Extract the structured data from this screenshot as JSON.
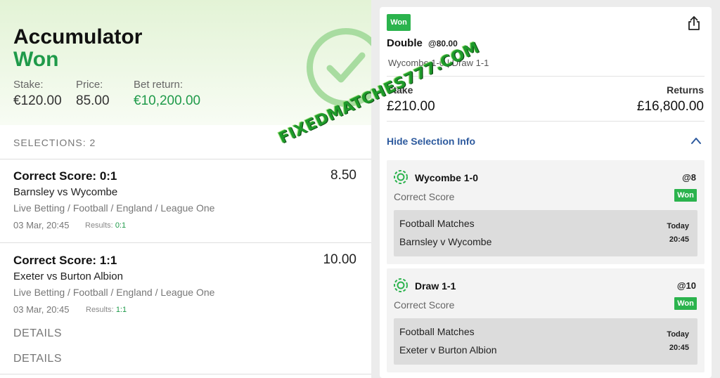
{
  "left": {
    "title": "Accumulator",
    "status": "Won",
    "stake_label": "Stake:",
    "stake_value": "€120.00",
    "price_label": "Price:",
    "price_value": "85.00",
    "return_label": "Bet return:",
    "return_value": "€10,200.00",
    "selections_label": "SELECTIONS: 2",
    "legs": [
      {
        "market": "Correct Score: 0:1",
        "price": "8.50",
        "event": "Barnsley vs Wycombe",
        "path": "Live Betting / Football / England / League One",
        "date": "03 Mar, 20:45",
        "results_label": "Results:",
        "results_value": "0:1"
      },
      {
        "market": "Correct Score: 1:1",
        "price": "10.00",
        "event": "Exeter vs Burton Albion",
        "path": "Live Betting / Football / England / League One",
        "date": "03 Mar, 20:45",
        "results_label": "Results:",
        "results_value": "1:1"
      }
    ],
    "details_1": "DETAILS",
    "details_2": "DETAILS"
  },
  "right": {
    "won_badge": "Won",
    "bet_type": "Double",
    "bet_odds": "@80.00",
    "bet_legs": "Wycombe 1-0 | Draw 1-1",
    "stake_label": "Stake",
    "stake_value": "£210.00",
    "returns_label": "Returns",
    "returns_value": "£16,800.00",
    "hide_selection": "Hide Selection Info",
    "selections": [
      {
        "name": "Wycombe 1-0",
        "odds": "@8",
        "market": "Correct Score",
        "status": "Won",
        "category": "Football Matches",
        "match": "Barnsley v Wycombe",
        "day": "Today",
        "time": "20:45"
      },
      {
        "name": "Draw 1-1",
        "odds": "@10",
        "market": "Correct Score",
        "status": "Won",
        "category": "Football Matches",
        "match": "Exeter v Burton Albion",
        "day": "Today",
        "time": "20:45"
      }
    ]
  },
  "watermark": "FIXEDMATCHES777.COM",
  "icons": {
    "tick": "check-circle-icon",
    "share": "share-icon",
    "chevron": "chevron-up-icon",
    "ball": "football-icon"
  },
  "colors": {
    "win_green": "#1f9a4a",
    "badge_green": "#2bb34d",
    "link_blue": "#2d5a9e",
    "watermark_green": "#1e9a2b"
  }
}
